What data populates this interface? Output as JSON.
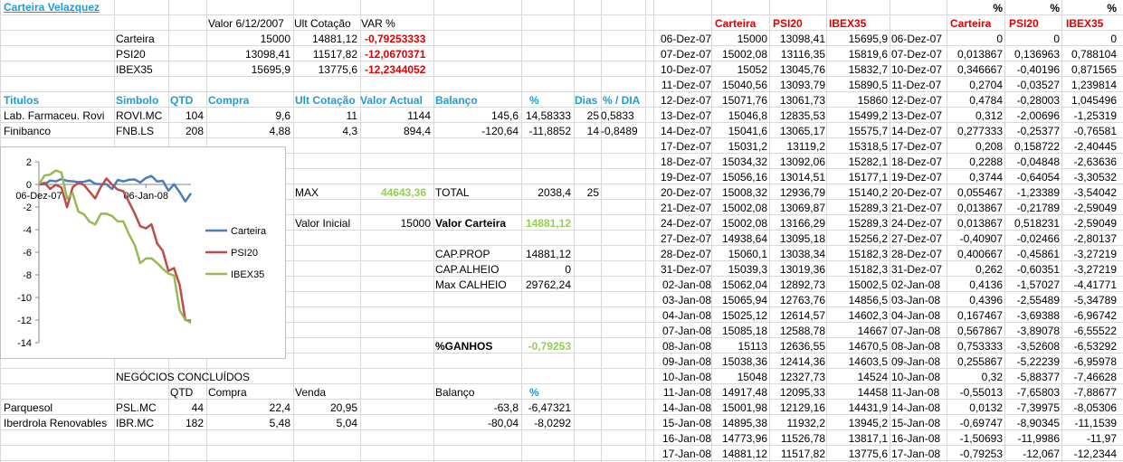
{
  "title": "Carteira Velazquez",
  "summary": {
    "headers": [
      "Valor 6/12/2007",
      "Ult Cotação",
      "VAR %"
    ],
    "rows": [
      {
        "name": "Carteira",
        "valor": "15000",
        "ult": "14881,12",
        "var": "-0,79253333"
      },
      {
        "name": "PSI20",
        "valor": "13098,41",
        "ult": "11517,82",
        "var": "-12,0670371"
      },
      {
        "name": "IBEX35",
        "valor": "15695,9",
        "ult": "13775,6",
        "var": "-12,2344052"
      }
    ]
  },
  "holdings": {
    "headers": [
      "Titulos",
      "Simbolo",
      "QTD",
      "Compra",
      "Ult Cotação",
      "Valor Actual",
      "Balanço",
      "%",
      "Dias",
      "% / DIA"
    ],
    "rows": [
      [
        "Lab. Farmaceu. Rovi",
        "ROVI.MC",
        "104",
        "9,6",
        "11",
        "1144",
        "145,6",
        "14,58333",
        "25",
        "0,5833"
      ],
      [
        "Finibanco",
        "FNB.LS",
        "208",
        "4,88",
        "4,3",
        "894,4",
        "-120,64",
        "-11,8852",
        "14",
        "-0,8489"
      ]
    ]
  },
  "stats": {
    "max_label": "MAX",
    "max_value": "44643,36",
    "total_label": "TOTAL",
    "total_value": "2038,4",
    "total_days": "25",
    "valor_inicial_label": "Valor Inicial",
    "valor_inicial": "15000",
    "valor_carteira_label": "Valor Carteira",
    "valor_carteira": "14881,12",
    "cap_prop_label": "CAP.PROP",
    "cap_prop": "14881,12",
    "cap_alheio_label": "CAP.ALHEIO",
    "cap_alheio": "0",
    "max_calheio_label": "Max CALHEIO",
    "max_calheio": "29762,24",
    "ganhos_label": "%GANHOS",
    "ganhos": "-0,79253"
  },
  "closed": {
    "title": "NEGÓCIOS CONCLUÍDOS",
    "headers": [
      "QTD",
      "Compra",
      "Venda",
      "Balanço",
      "%"
    ],
    "rows": [
      [
        "Parquesol",
        "PSL.MC",
        "44",
        "22,4",
        "20,95",
        "-63,8",
        "-6,47321"
      ],
      [
        "Iberdrola Renovables",
        "IBR.MC",
        "182",
        "5,48",
        "5,04",
        "-80,04",
        "-8,0292"
      ]
    ]
  },
  "history": {
    "headers": [
      "Carteira",
      "PSI20",
      "IBEX35"
    ],
    "pct_top": "%",
    "pct_headers": [
      "Carteira",
      "PSI20",
      "IBEX35"
    ],
    "rows": [
      [
        "06-Dez-07",
        "15000",
        "13098,41",
        "15695,9",
        "06-Dez-07",
        "0",
        "0",
        "0"
      ],
      [
        "07-Dez-07",
        "15002,08",
        "13116,35",
        "15819,6",
        "07-Dez-07",
        "0,013867",
        "0,136963",
        "0,788104"
      ],
      [
        "10-Dez-07",
        "15052",
        "13045,76",
        "15832,7",
        "10-Dez-07",
        "0,346667",
        "-0,40196",
        "0,871565"
      ],
      [
        "11-Dez-07",
        "15040,56",
        "13093,79",
        "15890,5",
        "11-Dez-07",
        "0,2704",
        "-0,03527",
        "1,239814"
      ],
      [
        "12-Dez-07",
        "15071,76",
        "13061,73",
        "15860",
        "12-Dez-07",
        "0,4784",
        "-0,28003",
        "1,045496"
      ],
      [
        "13-Dez-07",
        "15046,8",
        "12835,53",
        "15499,2",
        "13-Dez-07",
        "0,312",
        "-2,00696",
        "-1,25319"
      ],
      [
        "14-Dez-07",
        "15041,6",
        "13065,17",
        "15575,7",
        "14-Dez-07",
        "0,277333",
        "-0,25377",
        "-0,76581"
      ],
      [
        "17-Dez-07",
        "15031,2",
        "13119,2",
        "15318,5",
        "17-Dez-07",
        "0,208",
        "0,158722",
        "-2,40445"
      ],
      [
        "18-Dez-07",
        "15034,32",
        "13092,06",
        "15282,1",
        "18-Dez-07",
        "0,2288",
        "-0,04848",
        "-2,63636"
      ],
      [
        "19-Dez-07",
        "15056,16",
        "13014,51",
        "15177,1",
        "19-Dez-07",
        "0,3744",
        "-0,64054",
        "-3,30532"
      ],
      [
        "20-Dez-07",
        "15008,32",
        "12936,79",
        "15140,2",
        "20-Dez-07",
        "0,055467",
        "-1,23389",
        "-3,54042"
      ],
      [
        "21-Dez-07",
        "15002,08",
        "13069,87",
        "15289,3",
        "21-Dez-07",
        "0,013867",
        "-0,21789",
        "-2,59049"
      ],
      [
        "24-Dez-07",
        "15002,08",
        "13166,29",
        "15289,3",
        "24-Dez-07",
        "0,013867",
        "0,518231",
        "-2,59049"
      ],
      [
        "27-Dez-07",
        "14938,64",
        "13095,18",
        "15256,2",
        "27-Dez-07",
        "-0,40907",
        "-0,02466",
        "-2,80137"
      ],
      [
        "28-Dez-07",
        "15060,1",
        "13038,34",
        "15182,3",
        "28-Dez-07",
        "0,400667",
        "-0,45861",
        "-3,27219"
      ],
      [
        "31-Dez-07",
        "15039,3",
        "13019,36",
        "15182,3",
        "31-Dez-07",
        "0,262",
        "-0,60351",
        "-3,27219"
      ],
      [
        "02-Jan-08",
        "15062,04",
        "12892,73",
        "15002,5",
        "02-Jan-08",
        "0,4136",
        "-1,57027",
        "-4,41771"
      ],
      [
        "03-Jan-08",
        "15065,94",
        "12763,76",
        "14856,5",
        "03-Jan-08",
        "0,4396",
        "-2,55489",
        "-5,34789"
      ],
      [
        "04-Jan-08",
        "15025,12",
        "12614,57",
        "14602,3",
        "04-Jan-08",
        "0,167467",
        "-3,69388",
        "-6,96742"
      ],
      [
        "07-Jan-08",
        "15085,18",
        "12588,78",
        "14667",
        "07-Jan-08",
        "0,567867",
        "-3,89078",
        "-6,55522"
      ],
      [
        "08-Jan-08",
        "15113",
        "12636,55",
        "14670,5",
        "08-Jan-08",
        "0,753333",
        "-3,52608",
        "-6,53292"
      ],
      [
        "09-Jan-08",
        "15038,36",
        "12414,36",
        "14603,5",
        "09-Jan-08",
        "0,255867",
        "-5,22239",
        "-6,95978"
      ],
      [
        "10-Jan-08",
        "15048",
        "12327,73",
        "14524",
        "10-Jan-08",
        "0,32",
        "-5,88377",
        "-7,46628"
      ],
      [
        "11-Jan-08",
        "14917,48",
        "12095,33",
        "14458",
        "11-Jan-08",
        "-0,55013",
        "-7,65803",
        "-7,88677"
      ],
      [
        "14-Jan-08",
        "15001,98",
        "12129,16",
        "14431,9",
        "14-Jan-08",
        "0,0132",
        "-7,39975",
        "-8,05306"
      ],
      [
        "15-Jan-08",
        "14895,38",
        "11932,2",
        "13945,2",
        "15-Jan-08",
        "-0,69747",
        "-8,90345",
        "-11,1539"
      ],
      [
        "16-Jan-08",
        "14773,96",
        "11526,78",
        "13817,1",
        "16-Jan-08",
        "-1,50693",
        "-11,9986",
        "-11,97"
      ],
      [
        "17-Jan-08",
        "14881,12",
        "11517,82",
        "13775,6",
        "17-Jan-08",
        "-0,79253",
        "-12,067",
        "-12,2344"
      ]
    ]
  },
  "chart_data": {
    "type": "line",
    "x": [
      "06-Dez-07",
      "07-Dez-07",
      "10-Dez-07",
      "11-Dez-07",
      "12-Dez-07",
      "13-Dez-07",
      "14-Dez-07",
      "17-Dez-07",
      "18-Dez-07",
      "19-Dez-07",
      "20-Dez-07",
      "21-Dez-07",
      "24-Dez-07",
      "27-Dez-07",
      "28-Dez-07",
      "31-Dez-07",
      "02-Jan-08",
      "03-Jan-08",
      "04-Jan-08",
      "07-Jan-08",
      "08-Jan-08",
      "09-Jan-08",
      "10-Jan-08",
      "11-Jan-08",
      "14-Jan-08",
      "15-Jan-08",
      "16-Jan-08",
      "17-Jan-08"
    ],
    "x_tick_labels": [
      "06-Dez-07",
      "06-Jan-08"
    ],
    "ylim": [
      -14,
      2
    ],
    "y_ticks": [
      "2",
      "0",
      "-2",
      "-4",
      "-6",
      "-8",
      "-10",
      "-12",
      "-14"
    ],
    "legend_position": "right",
    "series": [
      {
        "name": "Carteira",
        "color": "#4a7ebb",
        "values": [
          0,
          0.013867,
          0.346667,
          0.2704,
          0.4784,
          0.312,
          0.277333,
          0.208,
          0.2288,
          0.3744,
          0.055467,
          0.013867,
          0.013867,
          -0.40907,
          0.400667,
          0.262,
          0.4136,
          0.4396,
          0.167467,
          0.567867,
          0.753333,
          0.255867,
          0.32,
          -0.55013,
          0.0132,
          -0.69747,
          -1.50693,
          -0.79253
        ]
      },
      {
        "name": "PSI20",
        "color": "#be4b48",
        "values": [
          0,
          0.136963,
          -0.40196,
          -0.03527,
          -0.28003,
          -2.00696,
          -0.25377,
          0.158722,
          -0.04848,
          -0.64054,
          -1.23389,
          -0.21789,
          0.518231,
          -0.02466,
          -0.45861,
          -0.60351,
          -1.57027,
          -2.55489,
          -3.69388,
          -3.89078,
          -3.52608,
          -5.22239,
          -5.88377,
          -7.65803,
          -7.39975,
          -8.90345,
          -11.9986,
          -12.067
        ]
      },
      {
        "name": "IBEX35",
        "color": "#98b954",
        "values": [
          0,
          0.788104,
          0.871565,
          1.239814,
          1.045496,
          -1.25319,
          -0.76581,
          -2.40445,
          -2.63636,
          -3.30532,
          -3.54042,
          -2.59049,
          -2.59049,
          -2.80137,
          -3.27219,
          -3.27219,
          -4.41771,
          -5.34789,
          -6.96742,
          -6.55522,
          -6.53292,
          -6.95978,
          -7.46628,
          -7.88677,
          -8.05306,
          -11.1539,
          -11.97,
          -12.2344
        ]
      }
    ]
  }
}
